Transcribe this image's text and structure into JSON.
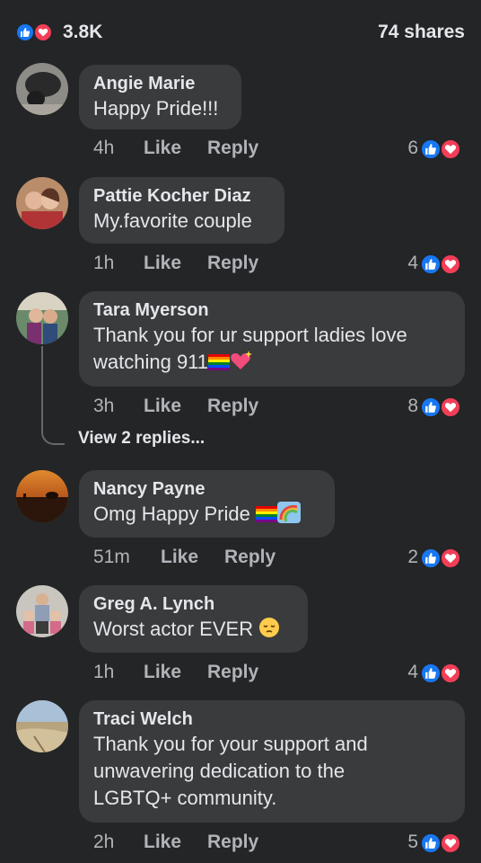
{
  "header": {
    "reaction_count": "3.8K",
    "shares": "74 shares",
    "reaction_icons": [
      "like-icon",
      "love-icon"
    ]
  },
  "colors": {
    "background": "#242526",
    "bubble": "#3a3b3c",
    "like_blue": "#1877f2",
    "love_red": "#f33e58",
    "secondary_text": "#b0b3b8"
  },
  "comments": [
    {
      "name": "Angie Marie",
      "text": "Happy Pride!!!",
      "time": "4h",
      "like": "Like",
      "reply": "Reply",
      "reactions": "6"
    },
    {
      "name": "Pattie Kocher Diaz",
      "text": "My.favorite couple",
      "time": "1h",
      "like": "Like",
      "reply": "Reply",
      "reactions": "4"
    },
    {
      "name": "Tara Myerson",
      "text": "Thank you for ur support ladies love\nwatching 911",
      "time": "3h",
      "like": "Like",
      "reply": "Reply",
      "reactions": "8",
      "view_replies": "View 2 replies..."
    },
    {
      "name": "Nancy Payne",
      "text": "Omg Happy Pride",
      "time": "51m",
      "like": "Like",
      "reply": "Reply",
      "reactions": "2"
    },
    {
      "name": "Greg A. Lynch",
      "text": "Worst actor EVER",
      "time": "1h",
      "like": "Like",
      "reply": "Reply",
      "reactions": "4"
    },
    {
      "name": "Traci Welch",
      "text": "Thank you for your support and\nunwavering dedication to the\nLGBTQ+ community.",
      "time": "2h",
      "like": "Like",
      "reply": "Reply",
      "reactions": "5"
    }
  ]
}
